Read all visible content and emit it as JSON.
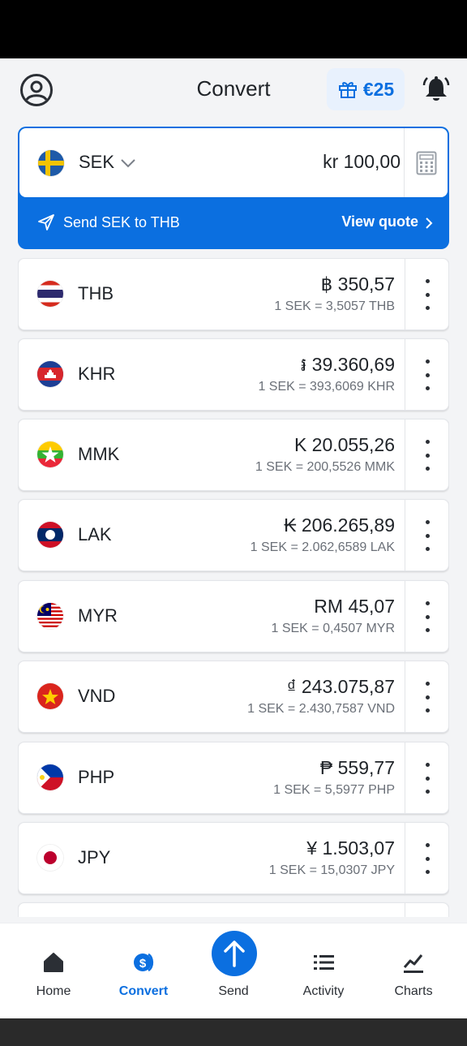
{
  "header": {
    "title": "Convert",
    "reward_amount": "€25",
    "avatar_icon": "user-circle-icon",
    "gift_icon": "gift-icon",
    "bell_icon": "bell-icon"
  },
  "base": {
    "code": "SEK",
    "flag": "sweden",
    "amount": "kr 100,00",
    "send_label": "Send SEK to THB",
    "view_quote": "View quote"
  },
  "currencies": [
    {
      "code": "THB",
      "flag": "thailand",
      "amount": "฿ 350,57",
      "rate": "1 SEK = 3,5057 THB"
    },
    {
      "code": "KHR",
      "flag": "cambodia",
      "amount": "៛ 39.360,69",
      "rate": "1 SEK = 393,6069 KHR"
    },
    {
      "code": "MMK",
      "flag": "myanmar",
      "amount": "K 20.055,26",
      "rate": "1 SEK = 200,5526 MMK"
    },
    {
      "code": "LAK",
      "flag": "laos",
      "amount": "₭ 206.265,89",
      "rate": "1 SEK = 2.062,6589 LAK"
    },
    {
      "code": "MYR",
      "flag": "malaysia",
      "amount": "RM 45,07",
      "rate": "1 SEK = 0,4507 MYR"
    },
    {
      "code": "VND",
      "flag": "vietnam",
      "amount": "₫ 243.075,87",
      "rate": "1 SEK = 2.430,7587 VND"
    },
    {
      "code": "PHP",
      "flag": "philippines",
      "amount": "₱ 559,77",
      "rate": "1 SEK = 5,5977 PHP"
    },
    {
      "code": "JPY",
      "flag": "japan",
      "amount": "¥ 1.503,07",
      "rate": "1 SEK = 15,0307 JPY"
    }
  ],
  "tabs": [
    {
      "label": "Home",
      "icon": "home-icon",
      "active": false
    },
    {
      "label": "Convert",
      "icon": "convert-icon",
      "active": true
    },
    {
      "label": "Send",
      "icon": "send-arrow-icon",
      "active": false
    },
    {
      "label": "Activity",
      "icon": "list-icon",
      "active": false
    },
    {
      "label": "Charts",
      "icon": "chart-icon",
      "active": false
    }
  ],
  "colors": {
    "accent": "#0b6fe0",
    "background": "#f3f4f6"
  }
}
